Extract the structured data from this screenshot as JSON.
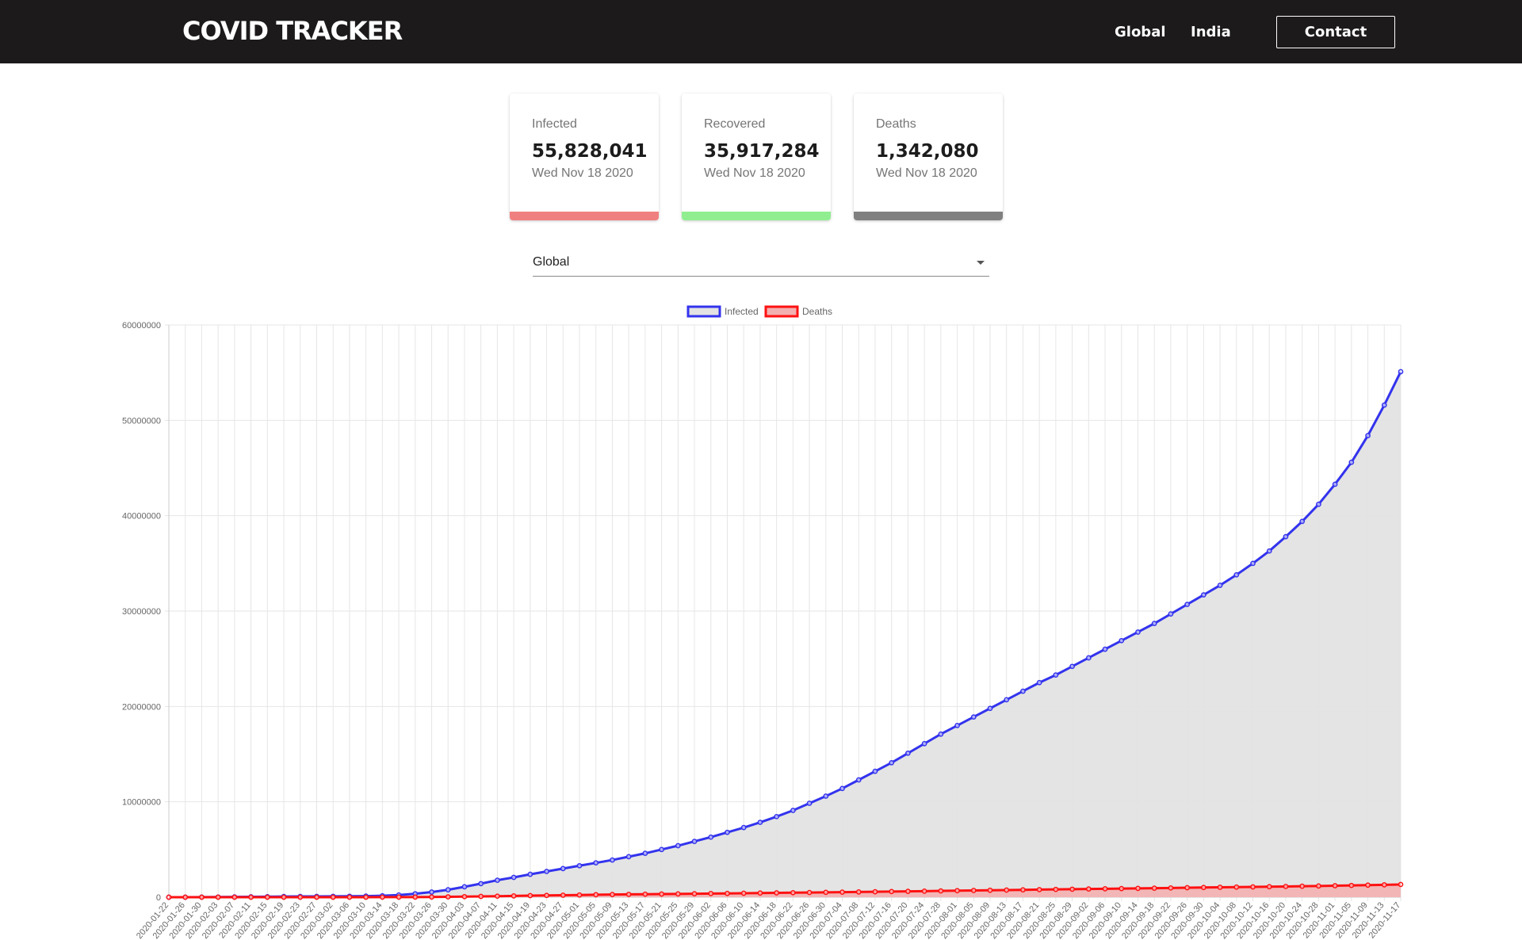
{
  "header": {
    "brand": "COVID TRACKER",
    "nav": {
      "global": "Global",
      "india": "India"
    },
    "contact": "Contact"
  },
  "cards": [
    {
      "title": "Infected",
      "value": "55,828,041",
      "date": "Wed Nov 18 2020",
      "color": "#f08080"
    },
    {
      "title": "Recovered",
      "value": "35,917,284",
      "date": "Wed Nov 18 2020",
      "color": "#90ee90"
    },
    {
      "title": "Deaths",
      "value": "1,342,080",
      "date": "Wed Nov 18 2020",
      "color": "#808080"
    }
  ],
  "country_select": {
    "selected": "Global"
  },
  "chart_data": {
    "type": "line",
    "title": "",
    "xlabel": "",
    "ylabel": "",
    "ylim": [
      0,
      60000000
    ],
    "yticks": [
      0,
      10000000,
      20000000,
      30000000,
      40000000,
      50000000,
      60000000
    ],
    "grid": true,
    "legend_position": "top",
    "x": [
      "2020-01-22",
      "2020-01-26",
      "2020-01-30",
      "2020-02-03",
      "2020-02-07",
      "2020-02-11",
      "2020-02-15",
      "2020-02-19",
      "2020-02-23",
      "2020-02-27",
      "2020-03-02",
      "2020-03-06",
      "2020-03-10",
      "2020-03-14",
      "2020-03-18",
      "2020-03-22",
      "2020-03-26",
      "2020-03-30",
      "2020-04-03",
      "2020-04-07",
      "2020-04-11",
      "2020-04-15",
      "2020-04-19",
      "2020-04-23",
      "2020-04-27",
      "2020-05-01",
      "2020-05-05",
      "2020-05-09",
      "2020-05-13",
      "2020-05-17",
      "2020-05-21",
      "2020-05-25",
      "2020-05-29",
      "2020-06-02",
      "2020-06-06",
      "2020-06-10",
      "2020-06-14",
      "2020-06-18",
      "2020-06-22",
      "2020-06-26",
      "2020-06-30",
      "2020-07-04",
      "2020-07-08",
      "2020-07-12",
      "2020-07-16",
      "2020-07-20",
      "2020-07-24",
      "2020-07-28",
      "2020-08-01",
      "2020-08-05",
      "2020-08-09",
      "2020-08-13",
      "2020-08-17",
      "2020-08-21",
      "2020-08-25",
      "2020-08-29",
      "2020-09-02",
      "2020-09-06",
      "2020-09-10",
      "2020-09-14",
      "2020-09-18",
      "2020-09-22",
      "2020-09-26",
      "2020-09-30",
      "2020-10-04",
      "2020-10-08",
      "2020-10-12",
      "2020-10-16",
      "2020-10-20",
      "2020-10-24",
      "2020-10-28",
      "2020-11-01",
      "2020-11-05",
      "2020-11-09",
      "2020-11-13",
      "2020-11-17"
    ],
    "series": [
      {
        "name": "Infected",
        "color": "#3333ee",
        "fill": "#e3e3e3",
        "values": [
          600,
          2000,
          8000,
          17000,
          30000,
          43000,
          50000,
          75000,
          79000,
          83000,
          90000,
          100000,
          117000,
          152000,
          230000,
          360000,
          540000,
          780000,
          1090000,
          1420000,
          1780000,
          2080000,
          2400000,
          2700000,
          3000000,
          3300000,
          3600000,
          3900000,
          4250000,
          4600000,
          5000000,
          5400000,
          5850000,
          6300000,
          6800000,
          7300000,
          7850000,
          8450000,
          9100000,
          9850000,
          10600000,
          11400000,
          12300000,
          13200000,
          14100000,
          15100000,
          16100000,
          17100000,
          18000000,
          18900000,
          19800000,
          20700000,
          21600000,
          22500000,
          23300000,
          24200000,
          25100000,
          26000000,
          26900000,
          27800000,
          28700000,
          29700000,
          30700000,
          31700000,
          32700000,
          33800000,
          35000000,
          36300000,
          37800000,
          39400000,
          41200000,
          43300000,
          45600000,
          48400000,
          51600000,
          55100000
        ]
      },
      {
        "name": "Deaths",
        "color": "#ff1111",
        "fill": "#f3b0b0",
        "values": [
          17,
          56,
          170,
          426,
          564,
          1113,
          1666,
          2122,
          2469,
          2813,
          3120,
          3460,
          4260,
          5830,
          9100,
          14800,
          23700,
          37800,
          59000,
          82000,
          109000,
          134000,
          164000,
          190000,
          211000,
          233000,
          257000,
          279000,
          298000,
          317000,
          332000,
          347000,
          364000,
          382000,
          398000,
          416000,
          434000,
          454000,
          473000,
          493000,
          513000,
          531000,
          551000,
          571000,
          593000,
          614000,
          636000,
          660000,
          684000,
          706000,
          728000,
          750000,
          772000,
          795000,
          817000,
          838000,
          860000,
          881000,
          903000,
          925000,
          948000,
          971000,
          995000,
          1017000,
          1040000,
          1061000,
          1083000,
          1104000,
          1127000,
          1151000,
          1177000,
          1203000,
          1233000,
          1266000,
          1300000,
          1335000
        ]
      }
    ]
  }
}
